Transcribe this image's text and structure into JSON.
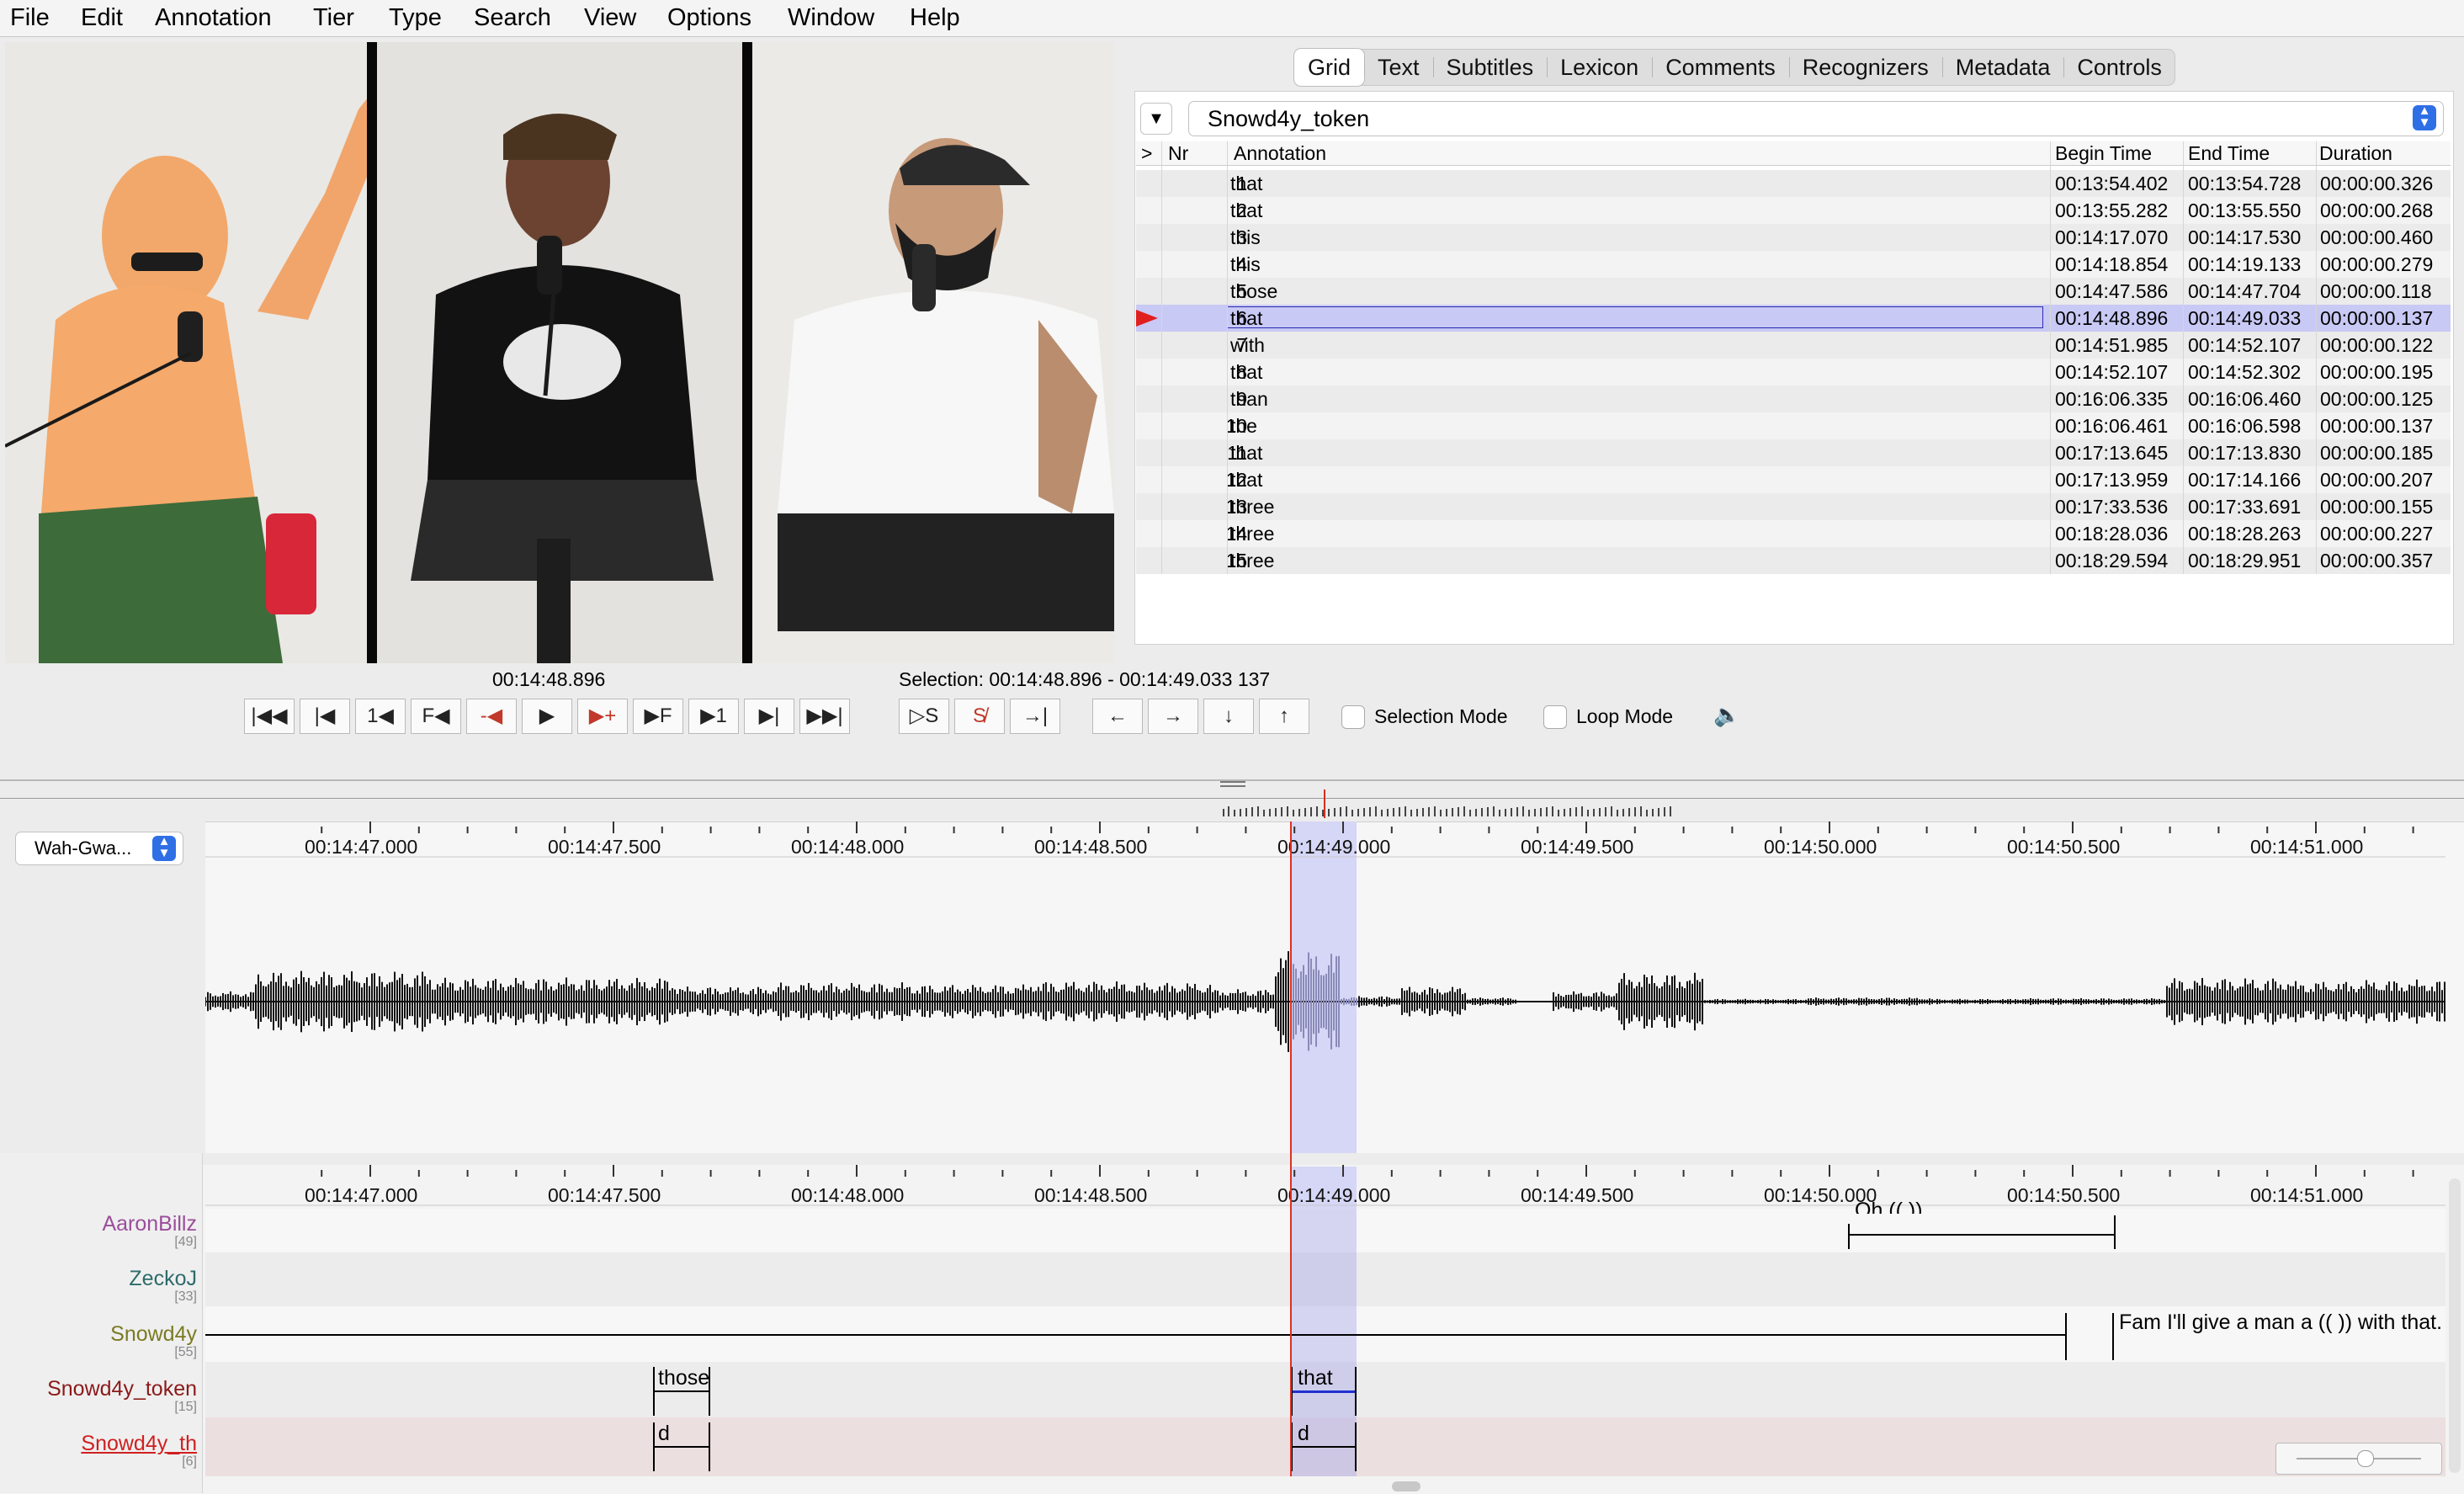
{
  "menu": [
    "File",
    "Edit",
    "Annotation",
    "Tier",
    "Type",
    "Search",
    "View",
    "Options",
    "Window",
    "Help"
  ],
  "tabs": [
    "Grid",
    "Text",
    "Subtitles",
    "Lexicon",
    "Comments",
    "Recognizers",
    "Metadata",
    "Controls"
  ],
  "selected_tab": "Grid",
  "grid": {
    "tier": "Snowd4y_token",
    "headers": {
      "arrow": ">",
      "nr": "Nr",
      "annotation": "Annotation",
      "begin": "Begin Time",
      "end": "End Time",
      "duration": "Duration"
    },
    "selected_row": 6,
    "rows": [
      {
        "nr": "1",
        "annotation": "that",
        "begin": "00:13:54.402",
        "end": "00:13:54.728",
        "duration": "00:00:00.326"
      },
      {
        "nr": "2",
        "annotation": "that",
        "begin": "00:13:55.282",
        "end": "00:13:55.550",
        "duration": "00:00:00.268"
      },
      {
        "nr": "3",
        "annotation": "this",
        "begin": "00:14:17.070",
        "end": "00:14:17.530",
        "duration": "00:00:00.460"
      },
      {
        "nr": "4",
        "annotation": "this",
        "begin": "00:14:18.854",
        "end": "00:14:19.133",
        "duration": "00:00:00.279"
      },
      {
        "nr": "5",
        "annotation": "those",
        "begin": "00:14:47.586",
        "end": "00:14:47.704",
        "duration": "00:00:00.118"
      },
      {
        "nr": "6",
        "annotation": "that",
        "begin": "00:14:48.896",
        "end": "00:14:49.033",
        "duration": "00:00:00.137"
      },
      {
        "nr": "7",
        "annotation": "with",
        "begin": "00:14:51.985",
        "end": "00:14:52.107",
        "duration": "00:00:00.122"
      },
      {
        "nr": "8",
        "annotation": "that",
        "begin": "00:14:52.107",
        "end": "00:14:52.302",
        "duration": "00:00:00.195"
      },
      {
        "nr": "9",
        "annotation": "than",
        "begin": "00:16:06.335",
        "end": "00:16:06.460",
        "duration": "00:00:00.125"
      },
      {
        "nr": "10",
        "annotation": "the",
        "begin": "00:16:06.461",
        "end": "00:16:06.598",
        "duration": "00:00:00.137"
      },
      {
        "nr": "11",
        "annotation": "that",
        "begin": "00:17:13.645",
        "end": "00:17:13.830",
        "duration": "00:00:00.185"
      },
      {
        "nr": "12",
        "annotation": "that",
        "begin": "00:17:13.959",
        "end": "00:17:14.166",
        "duration": "00:00:00.207"
      },
      {
        "nr": "13",
        "annotation": "three",
        "begin": "00:17:33.536",
        "end": "00:17:33.691",
        "duration": "00:00:00.155"
      },
      {
        "nr": "14",
        "annotation": "three",
        "begin": "00:18:28.036",
        "end": "00:18:28.263",
        "duration": "00:00:00.227"
      },
      {
        "nr": "15",
        "annotation": "three",
        "begin": "00:18:29.594",
        "end": "00:18:29.951",
        "duration": "00:00:00.357"
      }
    ]
  },
  "player": {
    "current_time": "00:14:48.896",
    "selection": "Selection: 00:14:48.896 - 00:14:49.033  137",
    "transport_icons": [
      "go-to-begin-icon",
      "previous-frame-icon",
      "step-back-1-icon",
      "frame-back-icon",
      "previous-boundary-icon",
      "play-icon",
      "next-boundary-icon",
      "frame-forward-icon",
      "step-forward-1-icon",
      "next-frame-icon",
      "go-to-end-icon"
    ],
    "selection_mode_label": "Selection Mode",
    "loop_mode_label": "Loop Mode"
  },
  "media_select": "Wah-Gwa...",
  "ruler_ticks": [
    "00:14:47.000",
    "00:14:47.500",
    "00:14:48.000",
    "00:14:48.500",
    "00:14:49.000",
    "00:14:49.500",
    "00:14:50.000",
    "00:14:50.500",
    "00:14:51.000"
  ],
  "tiers": [
    {
      "name": "AaronBillz",
      "count": "[49]",
      "color": "#9a4e9a"
    },
    {
      "name": "ZeckoJ",
      "count": "[33]",
      "color": "#2e6b6b"
    },
    {
      "name": "Snowd4y",
      "count": "[55]",
      "color": "#7a7a22"
    },
    {
      "name": "Snowd4y_token",
      "count": "[15]",
      "color": "#8b1a1a"
    },
    {
      "name": "Snowd4y_th",
      "count": "[6]",
      "color": "#d02020"
    }
  ],
  "tier_annotations": {
    "aaron": "Oh (( )).",
    "snowd4y": "Fam I'll give a man a (( )) with that.",
    "token_a": "those",
    "token_b": "that",
    "th_a": "d",
    "th_b": "d"
  },
  "colors": {
    "selection": "#c9c9f3",
    "cursor": "#e03020",
    "row_select": "#c9c9f5"
  }
}
